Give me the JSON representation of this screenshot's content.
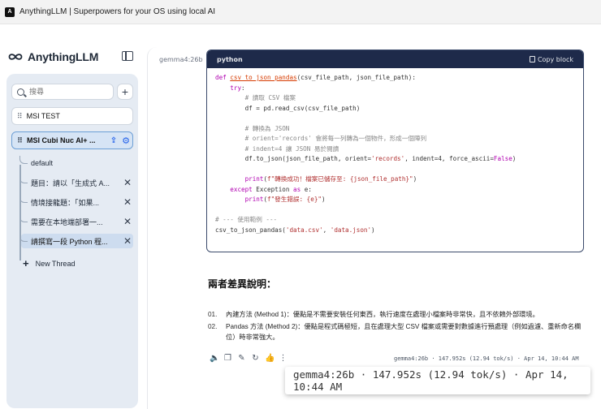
{
  "window": {
    "title": "AnythingLLM | Superpowers for your OS using local AI"
  },
  "sidebar": {
    "brand": "AnythingLLM",
    "search_placeholder": "搜尋",
    "workspaces": [
      {
        "name": "MSI TEST",
        "active": false
      },
      {
        "name": "MSI Cubi Nuc AI+ ...",
        "active": true
      }
    ],
    "threads": [
      {
        "label": "default",
        "closable": false,
        "active": false
      },
      {
        "label": "題目：請以「生成式 A...",
        "closable": true,
        "active": false
      },
      {
        "label": "情境接龍題：「如果...",
        "closable": true,
        "active": false
      },
      {
        "label": "需要在本地端部署一...",
        "closable": true,
        "active": false
      },
      {
        "label": "請撰寫一段 Python 程...",
        "closable": true,
        "active": true
      }
    ],
    "new_thread_label": "New Thread"
  },
  "chat": {
    "model_tag": "gemma4:26b",
    "code_block": {
      "language": "python",
      "copy_label": "Copy block"
    },
    "section_heading": "兩者差異說明：",
    "differences": [
      {
        "num": "01.",
        "text": "內建方法 (Method 1)：優點是不需要安裝任何東西，執行速度在處理小檔案時非常快，且不依賴外部環境。"
      },
      {
        "num": "02.",
        "text": "Pandas 方法 (Method 2)：優點是程式碼極短，且在處理大型 CSV 檔案或需要對數據進行預處理（例如過濾、重新命名欄位）時非常強大。"
      }
    ],
    "meta_small": "gemma4:26b · 147.952s (12.94 tok/s) · Apr 14, 10:44 AM",
    "tooltip": "gemma4:26b · 147.952s (12.94 tok/s) · Apr 14, 10:44 AM"
  }
}
